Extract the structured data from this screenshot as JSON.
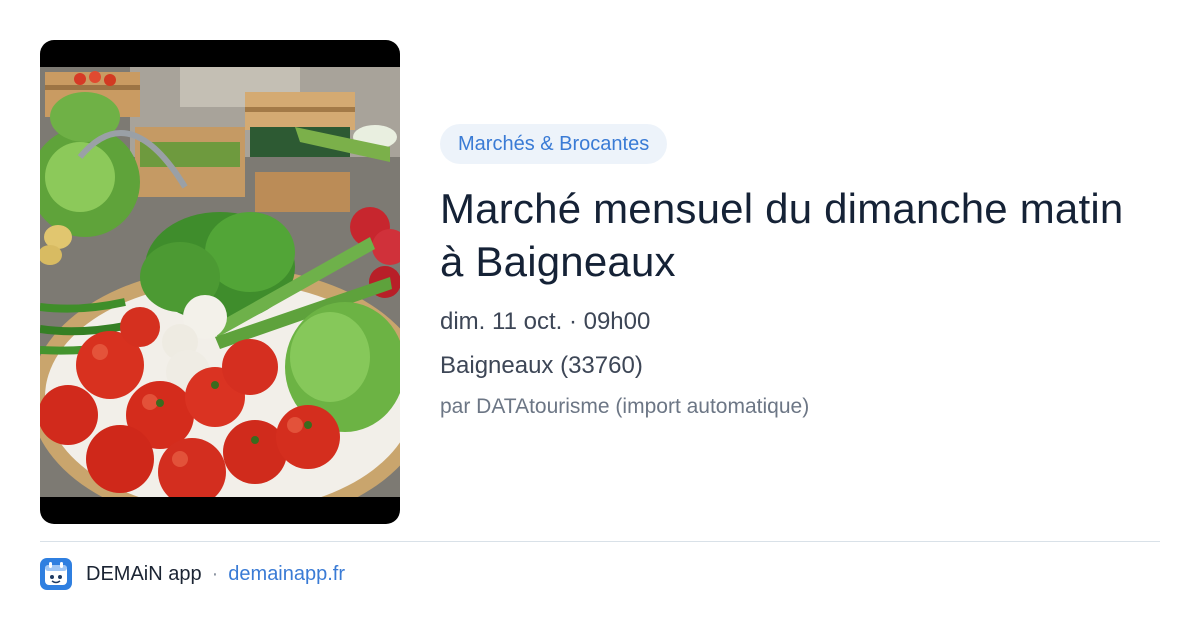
{
  "event": {
    "category": "Marchés & Brocantes",
    "title": "Marché mensuel du dimanche matin à Baigneaux",
    "datetime": "dim. 11 oct. · 09h00",
    "location": "Baigneaux (33760)",
    "source": "par DATAtourisme (import automatique)"
  },
  "footer": {
    "app_name": "DEMAiN app",
    "separator": "·",
    "link": "demainapp.fr"
  },
  "colors": {
    "accent": "#3a7bd5",
    "badge_bg": "#edf3fa",
    "title": "#152236"
  },
  "icons": {
    "logo": "demain-app-logo-icon"
  }
}
